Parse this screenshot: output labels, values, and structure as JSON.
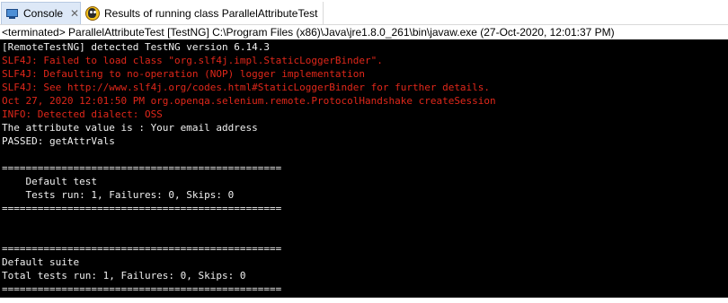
{
  "tabs": {
    "console_label": "Console",
    "results_label": "Results of running class ParallelAttributeTest"
  },
  "status": {
    "text": "<terminated> ParallelAttributeTest [TestNG] C:\\Program Files (x86)\\Java\\jre1.8.0_261\\bin\\javaw.exe (27-Oct-2020, 12:01:37 PM)"
  },
  "colors": {
    "stdout": "#f0f0f0",
    "stderr": "#e0271a",
    "background": "#000000",
    "active_tab": "#dde8f7"
  },
  "console": {
    "lines": [
      {
        "text": "[RemoteTestNG] detected TestNG version 6.14.3",
        "stream": "stdout"
      },
      {
        "text": "SLF4J: Failed to load class \"org.slf4j.impl.StaticLoggerBinder\".",
        "stream": "stderr"
      },
      {
        "text": "SLF4J: Defaulting to no-operation (NOP) logger implementation",
        "stream": "stderr"
      },
      {
        "text": "SLF4J: See http://www.slf4j.org/codes.html#StaticLoggerBinder for further details.",
        "stream": "stderr"
      },
      {
        "text": "Oct 27, 2020 12:01:50 PM org.openqa.selenium.remote.ProtocolHandshake createSession",
        "stream": "stderr"
      },
      {
        "text": "INFO: Detected dialect: OSS",
        "stream": "stderr"
      },
      {
        "text": "The attribute value is : Your email address",
        "stream": "stdout"
      },
      {
        "text": "PASSED: getAttrVals",
        "stream": "stdout"
      },
      {
        "text": "",
        "stream": "stdout"
      },
      {
        "text": "===============================================",
        "stream": "stdout"
      },
      {
        "text": "    Default test",
        "stream": "stdout"
      },
      {
        "text": "    Tests run: 1, Failures: 0, Skips: 0",
        "stream": "stdout"
      },
      {
        "text": "===============================================",
        "stream": "stdout"
      },
      {
        "text": "",
        "stream": "stdout"
      },
      {
        "text": "",
        "stream": "stdout"
      },
      {
        "text": "===============================================",
        "stream": "stdout"
      },
      {
        "text": "Default suite",
        "stream": "stdout"
      },
      {
        "text": "Total tests run: 1, Failures: 0, Skips: 0",
        "stream": "stdout"
      },
      {
        "text": "===============================================",
        "stream": "stdout"
      }
    ]
  }
}
